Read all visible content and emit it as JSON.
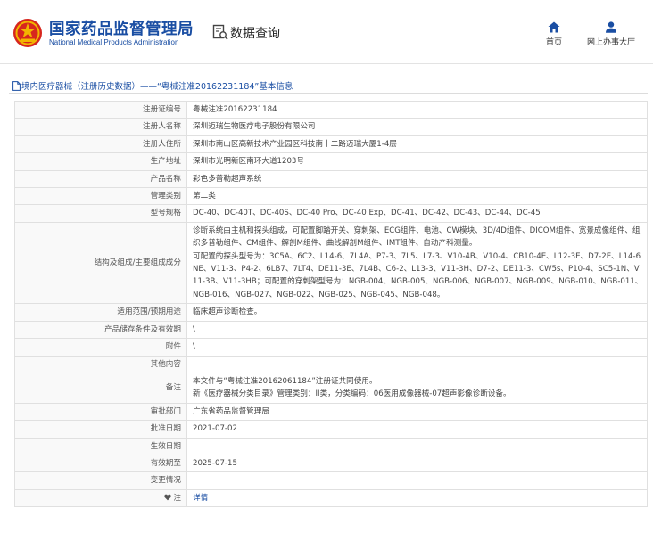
{
  "header": {
    "org_name_cn": "国家药品监督管理局",
    "org_name_en": "National Medical Products Administration",
    "query_title": "数据查询",
    "nav": [
      {
        "label": "首页",
        "icon": "home-icon"
      },
      {
        "label": "网上办事大厅",
        "icon": "user-icon"
      }
    ],
    "colors": {
      "brand": "#1a4ea3",
      "emblem_red": "#d7261e",
      "emblem_gold": "#f2b400"
    }
  },
  "breadcrumb": {
    "text": "境内医疗器械（注册历史数据）——“粤械注准20162231184”基本信息",
    "icon": "document-icon"
  },
  "table": {
    "rows": [
      {
        "label": "注册证编号",
        "value": "粤械注准20162231184"
      },
      {
        "label": "注册人名称",
        "value": "深圳迈瑞生物医疗电子股份有限公司"
      },
      {
        "label": "注册人住所",
        "value": "深圳市南山区高新技术产业园区科技南十二路迈瑞大厦1-4层"
      },
      {
        "label": "生产地址",
        "value": "深圳市光明新区南环大道1203号"
      },
      {
        "label": "产品名称",
        "value": "彩色多普勒超声系统"
      },
      {
        "label": "管理类别",
        "value": "第二类"
      },
      {
        "label": "型号规格",
        "value": "DC-40、DC-40T、DC-40S、DC-40 Pro、DC-40 Exp、DC-41、DC-42、DC-43、DC-44、DC-45"
      },
      {
        "label": "结构及组成/主要组成成分",
        "value": "诊断系统由主机和探头组成，可配置脚踏开关、穿刺架、ECG组件、电池、CW模块、3D/4D组件、DICOM组件、宽景成像组件、组织多普勒组件、CM组件、解剖M组件、曲线解剖M组件、IMT组件、自动产科测量。\n可配置的探头型号为：3C5A、6C2、L14-6、7L4A、P7-3、7L5、L7-3、V10-4B、V10-4、CB10-4E、L12-3E、D7-2E、L14-6NE、V11-3、P4-2、6LB7、7LT4、DE11-3E、7L4B、C6-2、L13-3、V11-3H、D7-2、DE11-3、CW5s、P10-4、SC5-1N、V11-3B、V11-3HB；可配置的穿刺架型号为：NGB-004、NGB-005、NGB-006、NGB-007、NGB-009、NGB-010、NGB-011、NGB-016、NGB-027、NGB-022、NGB-025、NGB-045、NGB-048。"
      },
      {
        "label": "适用范围/预期用途",
        "value": "临床超声诊断检查。"
      },
      {
        "label": "产品储存条件及有效期",
        "value": "\\"
      },
      {
        "label": "附件",
        "value": "\\"
      },
      {
        "label": "其他内容",
        "value": ""
      },
      {
        "label": "备注",
        "value": "本文件与“粤械注准20162061184”注册证共同使用。\n新《医疗器械分类目录》管理类别：II类，分类编码：06医用成像器械-07超声影像诊断设备。"
      },
      {
        "label": "审批部门",
        "value": "广东省药品监督管理局"
      },
      {
        "label": "批准日期",
        "value": "2021-07-02"
      },
      {
        "label": "生效日期",
        "value": ""
      },
      {
        "label": "有效期至",
        "value": "2025-07-15"
      },
      {
        "label": "变更情况",
        "value": ""
      }
    ],
    "note_row": {
      "label": "注",
      "value": "详情",
      "icon": "heart-icon"
    }
  }
}
